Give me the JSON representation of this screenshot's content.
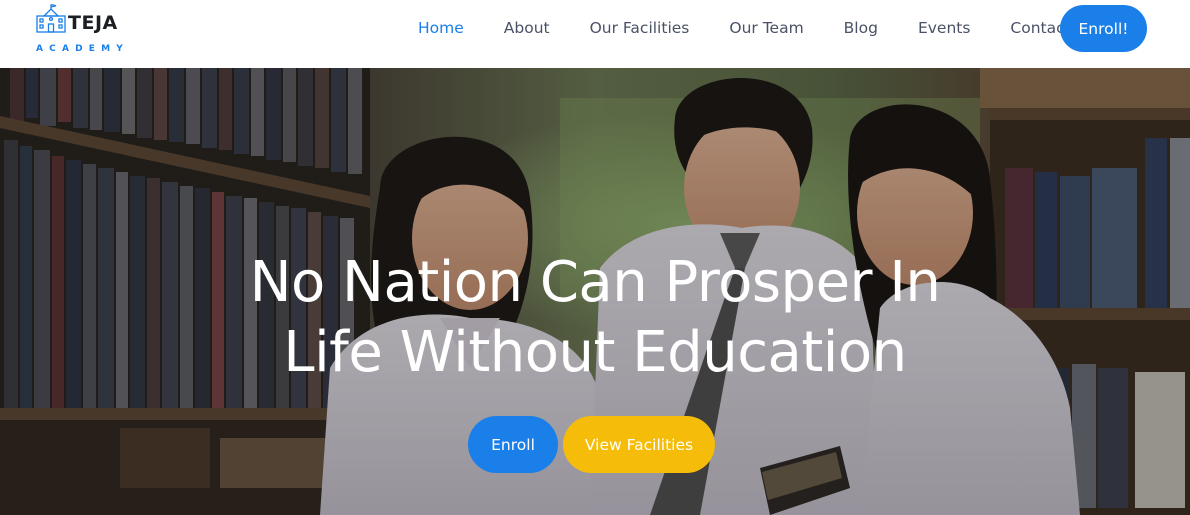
{
  "brand": {
    "name": "TEJA",
    "tagline": "ACADEMY",
    "icon": "school-building-icon",
    "accent_color": "#1a7fe8"
  },
  "nav": {
    "items": [
      {
        "label": "Home",
        "active": true
      },
      {
        "label": "About",
        "active": false
      },
      {
        "label": "Our Facilities",
        "active": false
      },
      {
        "label": "Our Team",
        "active": false
      },
      {
        "label": "Blog",
        "active": false
      },
      {
        "label": "Events",
        "active": false
      },
      {
        "label": "Contact",
        "active": false
      }
    ],
    "cta_label": "Enroll!"
  },
  "hero": {
    "headline_line1": "No Nation Can Prosper In",
    "headline_line2": "Life Without Education",
    "primary_button": "Enroll",
    "secondary_button": "View Facilities",
    "primary_color": "#1a7fe8",
    "secondary_color": "#f5bd09",
    "background_image": "students-in-library-photo"
  }
}
